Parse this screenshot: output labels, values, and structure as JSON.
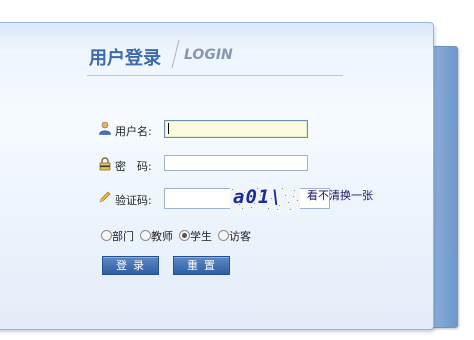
{
  "login": {
    "title": "用户登录",
    "subtitle": "LOGIN",
    "username_label": "用户名:",
    "username_value": "",
    "password_label": "密　码:",
    "password_value": "",
    "captcha_label": "验证码:",
    "captcha_value": "",
    "captcha_text": "a01\\",
    "refresh_link": "看不清换一张",
    "roles": [
      {
        "label": "部门",
        "checked": false
      },
      {
        "label": "教师",
        "checked": false
      },
      {
        "label": "学生",
        "checked": true
      },
      {
        "label": "访客",
        "checked": false
      }
    ],
    "login_button": "登录",
    "reset_button": "重置"
  },
  "icons": {
    "username": "user-icon",
    "password": "lock-icon",
    "captcha": "pencil-icon"
  }
}
